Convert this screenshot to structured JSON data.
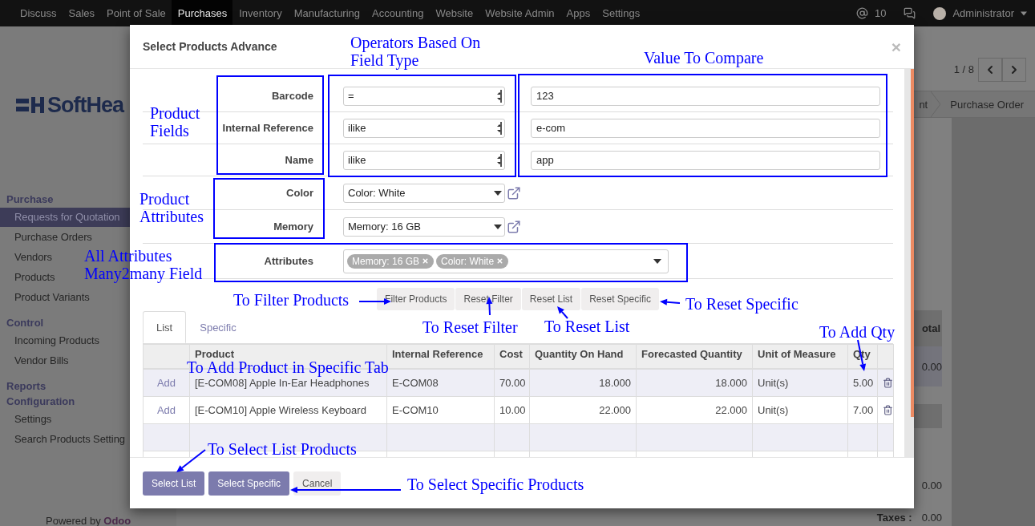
{
  "navbar": {
    "menu": [
      {
        "label": "Discuss",
        "selected": false
      },
      {
        "label": "Sales",
        "selected": false
      },
      {
        "label": "Point of Sale",
        "selected": false
      },
      {
        "label": "Purchases",
        "selected": true
      },
      {
        "label": "Inventory",
        "selected": false
      },
      {
        "label": "Manufacturing",
        "selected": false
      },
      {
        "label": "Accounting",
        "selected": false
      },
      {
        "label": "Website",
        "selected": false
      },
      {
        "label": "Website Admin",
        "selected": false
      },
      {
        "label": "Apps",
        "selected": false
      },
      {
        "label": "Settings",
        "selected": false
      }
    ],
    "mentions": "10",
    "user": "Administrator"
  },
  "sidebar": {
    "logo": "SoftHea",
    "sections": [
      {
        "title": "Purchase",
        "items": [
          {
            "label": "Requests for Quotation",
            "selected": true
          },
          {
            "label": "Purchase Orders",
            "selected": false
          },
          {
            "label": "Vendors",
            "selected": false
          },
          {
            "label": "Products",
            "selected": false
          },
          {
            "label": "Product Variants",
            "selected": false
          }
        ]
      },
      {
        "title": "Control",
        "items": [
          {
            "label": "Incoming Products",
            "selected": false
          },
          {
            "label": "Vendor Bills",
            "selected": false
          }
        ]
      },
      {
        "title": "Reports"
      },
      {
        "title": "Configuration",
        "items": [
          {
            "label": "Settings",
            "selected": false
          },
          {
            "label": "Search Products Setting",
            "selected": false
          }
        ]
      }
    ],
    "powered_by": "Powered by **Odoo**"
  },
  "control_panel": {
    "pager": "1 / 8",
    "stages": [
      "nt",
      "Purchase Order"
    ]
  },
  "order_summary": {
    "column_header": "otal",
    "line_total": "0.00",
    "untaxed": "0.00",
    "taxes_label": "Taxes :",
    "taxes": "0.00"
  },
  "dialog": {
    "title": "Select Products Advance",
    "close": "×",
    "field_filters": [
      {
        "label": "Barcode",
        "operator": "=",
        "value": "123"
      },
      {
        "label": "Internal Reference",
        "operator": "ilike",
        "value": "e-com"
      },
      {
        "label": "Name",
        "operator": "ilike",
        "value": "app"
      }
    ],
    "attribute_filters": [
      {
        "label": "Color",
        "value": "Color: White"
      },
      {
        "label": "Memory",
        "value": "Memory: 16 GB"
      }
    ],
    "attributes": {
      "label": "Attributes",
      "tags": [
        "Memory: 16 GB",
        "Color: White"
      ]
    },
    "actions": [
      "Filter Products",
      "Reset Filter",
      "Reset List",
      "Reset Specific"
    ],
    "tabs": [
      {
        "label": "List",
        "selected": true
      },
      {
        "label": "Specific",
        "selected": false
      }
    ],
    "table": {
      "columns": [
        "Product",
        "Internal Reference",
        "Cost",
        "Quantity On Hand",
        "Forecasted Quantity",
        "Unit of Measure",
        "Qty"
      ],
      "rows": [
        {
          "action": "Add",
          "product": "[E-COM08] Apple In-Ear Headphones",
          "reference": "E-COM08",
          "cost": "70.00",
          "on_hand": "18.000",
          "forecasted": "18.000",
          "uom": "Unit(s)",
          "qty": "5.00"
        },
        {
          "action": "Add",
          "product": "[E-COM10] Apple Wireless Keyboard",
          "reference": "E-COM10",
          "cost": "10.00",
          "on_hand": "22.000",
          "forecasted": "22.000",
          "uom": "Unit(s)",
          "qty": "7.00"
        }
      ]
    },
    "footer_buttons": [
      {
        "label": "Select List",
        "kind": "primary"
      },
      {
        "label": "Select Specific",
        "kind": "primary"
      },
      {
        "label": "Cancel",
        "kind": "secondary"
      }
    ]
  },
  "annotations": [
    {
      "text": "Operators Based On\nField Type",
      "kind": "frame"
    },
    {
      "text": "Value To Compare",
      "kind": "frame"
    },
    {
      "text": "Product\nFields",
      "kind": "frame"
    },
    {
      "text": "Product\nAttributes",
      "kind": "frame"
    },
    {
      "text": "All Attributes\nMany2many Field",
      "kind": "frame"
    },
    {
      "text": "To Filter Products",
      "kind": "arrow"
    },
    {
      "text": "To Reset Filter",
      "kind": "arrow"
    },
    {
      "text": "To Reset List",
      "kind": "arrow"
    },
    {
      "text": "To Reset Specific",
      "kind": "arrow"
    },
    {
      "text": "To Add Qty",
      "kind": "arrow"
    },
    {
      "text": "To Add Product in Specific Tab",
      "kind": "plain"
    },
    {
      "text": "To Select List Products",
      "kind": "arrow"
    },
    {
      "text": "To Select Specific Products",
      "kind": "arrow"
    }
  ]
}
